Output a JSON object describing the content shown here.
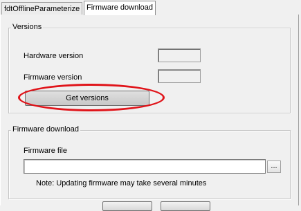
{
  "tabs": [
    {
      "label": "fdtOfflineParameterize"
    },
    {
      "label": "Firmware download"
    }
  ],
  "versions_group": {
    "legend": "Versions",
    "hardware_label": "Hardware version",
    "hardware_value": "",
    "firmware_label": "Firmware version",
    "firmware_value": "",
    "get_button_label": "Get versions"
  },
  "download_group": {
    "legend": "Firmware download",
    "file_label": "Firmware file",
    "file_value": "",
    "browse_label": "...",
    "note": "Note: Updating firmware may take several minutes"
  },
  "colors": {
    "highlight": "#e0141a"
  }
}
